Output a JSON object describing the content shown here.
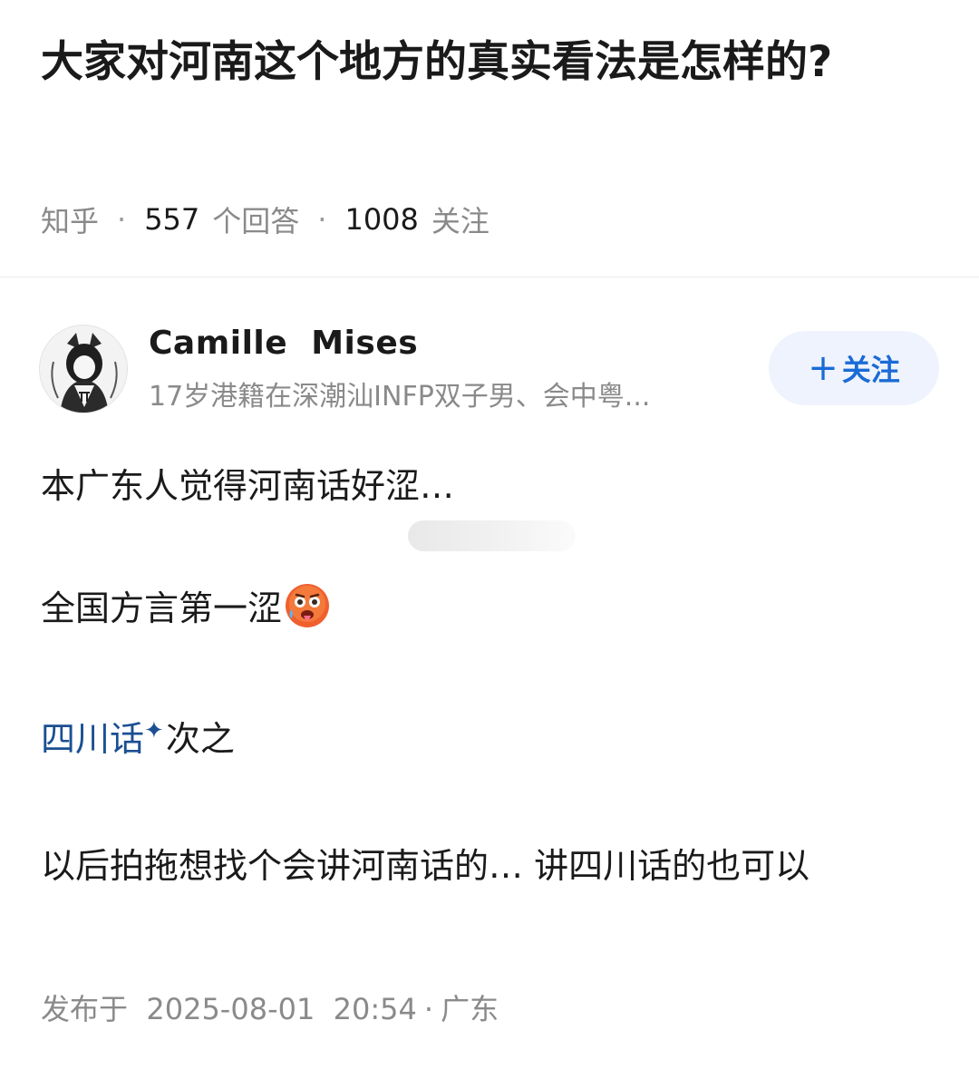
{
  "question": {
    "title": "大家对河南这个地方的真实看法是怎样的?",
    "source": "知乎",
    "answer_count": "557",
    "answer_label": "个回答",
    "follow_count": "1008",
    "follow_label": "关注"
  },
  "author": {
    "name": "Camille  Mises",
    "bio": "17岁港籍在深潮汕INFP双子男、会中粤...",
    "follow_button": "关注",
    "avatar": "avatar-anime-character"
  },
  "answer": {
    "p1": "本广东人觉得河南话好涩…",
    "p2": "全国方言第一涩",
    "p2_emoji": "hot-face-emoji",
    "p3_link": "四川话",
    "p3_spark": "✦",
    "p3_rest": "次之",
    "p4": "以后拍拖想找个会讲河南话的… 讲四川话的也可以"
  },
  "footer": {
    "published_prefix": "发布于",
    "date": "2025-08-01",
    "time": "20:54",
    "separator": "·",
    "location": "广东"
  },
  "colors": {
    "link": "#1b4f93",
    "follow_text": "#1a6bd6",
    "follow_bg": "#eef3fd",
    "meta_gray": "#8a8a8a"
  }
}
